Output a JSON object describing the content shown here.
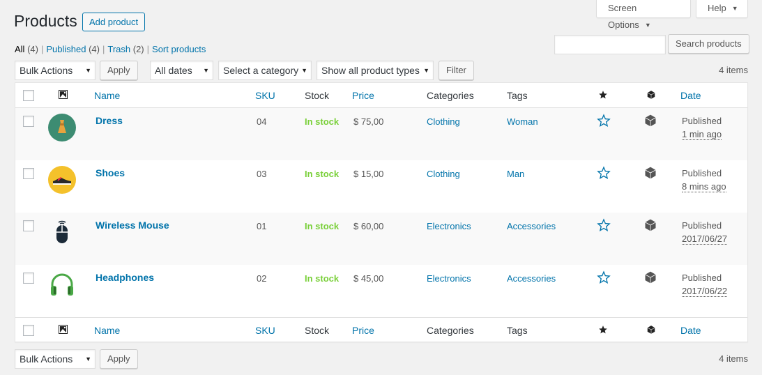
{
  "screen_tabs": {
    "screen_options": "Screen Options",
    "help": "Help"
  },
  "page": {
    "title": "Products",
    "add_button": "Add product"
  },
  "filters": {
    "all_label": "All",
    "all_count": "(4)",
    "published_label": "Published",
    "published_count": "(4)",
    "trash_label": "Trash",
    "trash_count": "(2)",
    "sort_label": "Sort products",
    "separator": "|"
  },
  "search": {
    "value": "",
    "button": "Search products"
  },
  "tablenav_top": {
    "bulk_actions": "Bulk Actions",
    "apply": "Apply",
    "dates": "All dates",
    "category": "Select a category",
    "product_types": "Show all product types",
    "filter": "Filter",
    "items": "4 items"
  },
  "columns": {
    "name": "Name",
    "sku": "SKU",
    "stock": "Stock",
    "price": "Price",
    "categories": "Categories",
    "tags": "Tags",
    "date": "Date"
  },
  "products": [
    {
      "name": "Dress",
      "sku": "04",
      "stock": "In stock",
      "price": "$ 75,00",
      "category": "Clothing",
      "tag": "Woman",
      "status": "Published",
      "date": "1 min ago",
      "thumb": "dress",
      "thumb_color": "#3d8c72"
    },
    {
      "name": "Shoes",
      "sku": "03",
      "stock": "In stock",
      "price": "$ 15,00",
      "category": "Clothing",
      "tag": "Man",
      "status": "Published",
      "date": "8 mins ago",
      "thumb": "shoe",
      "thumb_color": "#f4c12b"
    },
    {
      "name": "Wireless Mouse",
      "sku": "01",
      "stock": "In stock",
      "price": "$ 60,00",
      "category": "Electronics",
      "tag": "Accessories",
      "status": "Published",
      "date": "2017/06/27",
      "thumb": "mouse",
      "thumb_color": "#1c2b39"
    },
    {
      "name": "Headphones",
      "sku": "02",
      "stock": "In stock",
      "price": "$ 45,00",
      "category": "Electronics",
      "tag": "Accessories",
      "status": "Published",
      "date": "2017/06/22",
      "thumb": "headphones",
      "thumb_color": "#4aa846"
    }
  ],
  "tablenav_bottom": {
    "bulk_actions": "Bulk Actions",
    "apply": "Apply",
    "items": "4 items"
  },
  "colors": {
    "accent": "#0073aa",
    "in_stock": "#7ad03a",
    "background": "#f1f1f1"
  }
}
